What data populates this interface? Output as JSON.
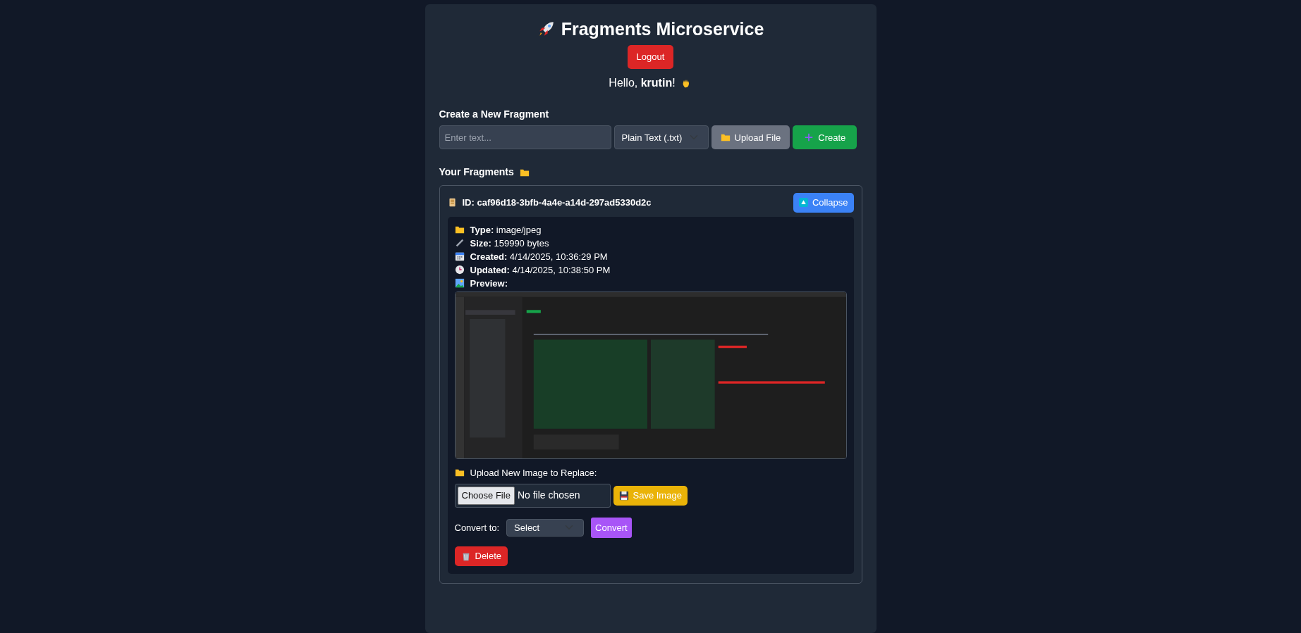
{
  "header": {
    "title": "Fragments Microservice",
    "logout_button": "Logout",
    "greeting": "Hello, **krutin**!"
  },
  "create_section": {
    "heading": "Create a New Fragment",
    "text_input": {
      "placeholder": "Enter text..."
    },
    "type_select": {
      "value": "Plain Text (.txt)"
    },
    "upload_button": "Upload File",
    "create_button": "Create"
  },
  "fragments_section": {
    "heading": "Your Fragments",
    "fragments": [
      {
        "id_label": "ID:",
        "id": "caf96d18-3bfb-4a4e-a14d-297ad5330d2c",
        "expanded": true,
        "toggle_button": "Collapse",
        "details": [
          {
            "kind": "type",
            "label": "Type:",
            "value": "image/jpeg"
          },
          {
            "kind": "size",
            "label": "Size:",
            "value": "159990 bytes"
          },
          {
            "kind": "created",
            "label": "Created:",
            "value": "4/14/2025, 10:36:29 PM"
          },
          {
            "kind": "updated",
            "label": "Updated:",
            "value": "4/14/2025, 10:38:50 PM"
          }
        ],
        "preview_label": "Preview:",
        "upload_label": "Upload New Image to Replace:",
        "file_button": "Choose File",
        "file_status": "No file chosen",
        "save_button": "Save Image",
        "convert_label": "Convert to:",
        "convert_select": {
          "value": "Select"
        },
        "convert_button": "Convert",
        "delete_button": "Delete"
      }
    ]
  }
}
